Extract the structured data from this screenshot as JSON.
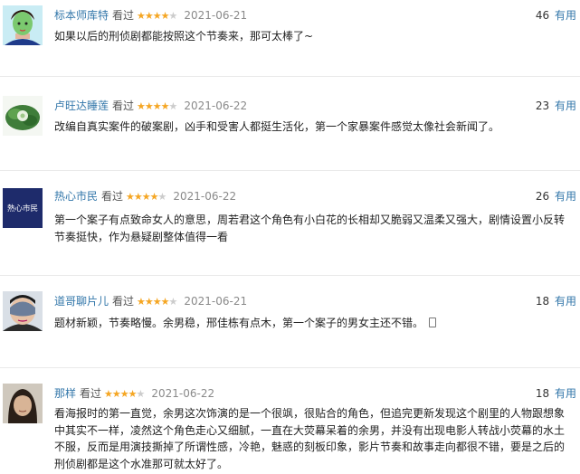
{
  "reviews": [
    {
      "user": "标本师库特",
      "status": "看过",
      "rating": 4,
      "date": "2021-06-21",
      "votes": "46",
      "useful_label": "有用",
      "text": "如果以后的刑侦剧都能按照这个节奏来，那可太棒了~",
      "avatar": "avatar-green-face-mask"
    },
    {
      "user": "卢旺达睡莲",
      "status": "看过",
      "rating": 4,
      "date": "2021-06-22",
      "votes": "23",
      "useful_label": "有用",
      "text": "改编自真实案件的破案剧，凶手和受害人都挺生活化，第一个家暴案件感觉太像社会新闻了。",
      "avatar": "avatar-water-lily"
    },
    {
      "user": "热心市民",
      "status": "看过",
      "rating": 4,
      "date": "2021-06-22",
      "votes": "26",
      "useful_label": "有用",
      "text": "第一个案子有点致命女人的意思，周若君这个角色有小白花的长相却又脆弱又温柔又强大，剧情设置小反转节奏挺快，作为悬疑剧整体值得一看",
      "avatar": "avatar-text-logo",
      "avatar_text": "熱心市民"
    },
    {
      "user": "道哥聊片儿",
      "status": "看过",
      "rating": 4,
      "date": "2021-06-21",
      "votes": "18",
      "useful_label": "有用",
      "text": "题材新颖，节奏略慢。余男稳，邢佳栋有点木，第一个案子的男女主还不错。",
      "avatar": "avatar-eye-mask"
    },
    {
      "user": "那样",
      "status": "看过",
      "rating": 4,
      "date": "2021-06-22",
      "votes": "18",
      "useful_label": "有用",
      "text": "看海报时的第一直觉，余男这次饰演的是一个很飒，很贴合的角色，但追完更新发现这个剧里的人物跟想象中其实不一样，凌然这个角色走心又细腻，一直在大荧幕呆着的余男，并没有出现电影人转战小荧幕的水土不服，反而是用演技撕掉了所谓性感，冷艳，魅惑的刻板印象，影片节奏和故事走向都很不错，要是之后的刑侦剧都是这个水准那可就太好了。",
      "avatar": "avatar-portrait-woman"
    }
  ]
}
